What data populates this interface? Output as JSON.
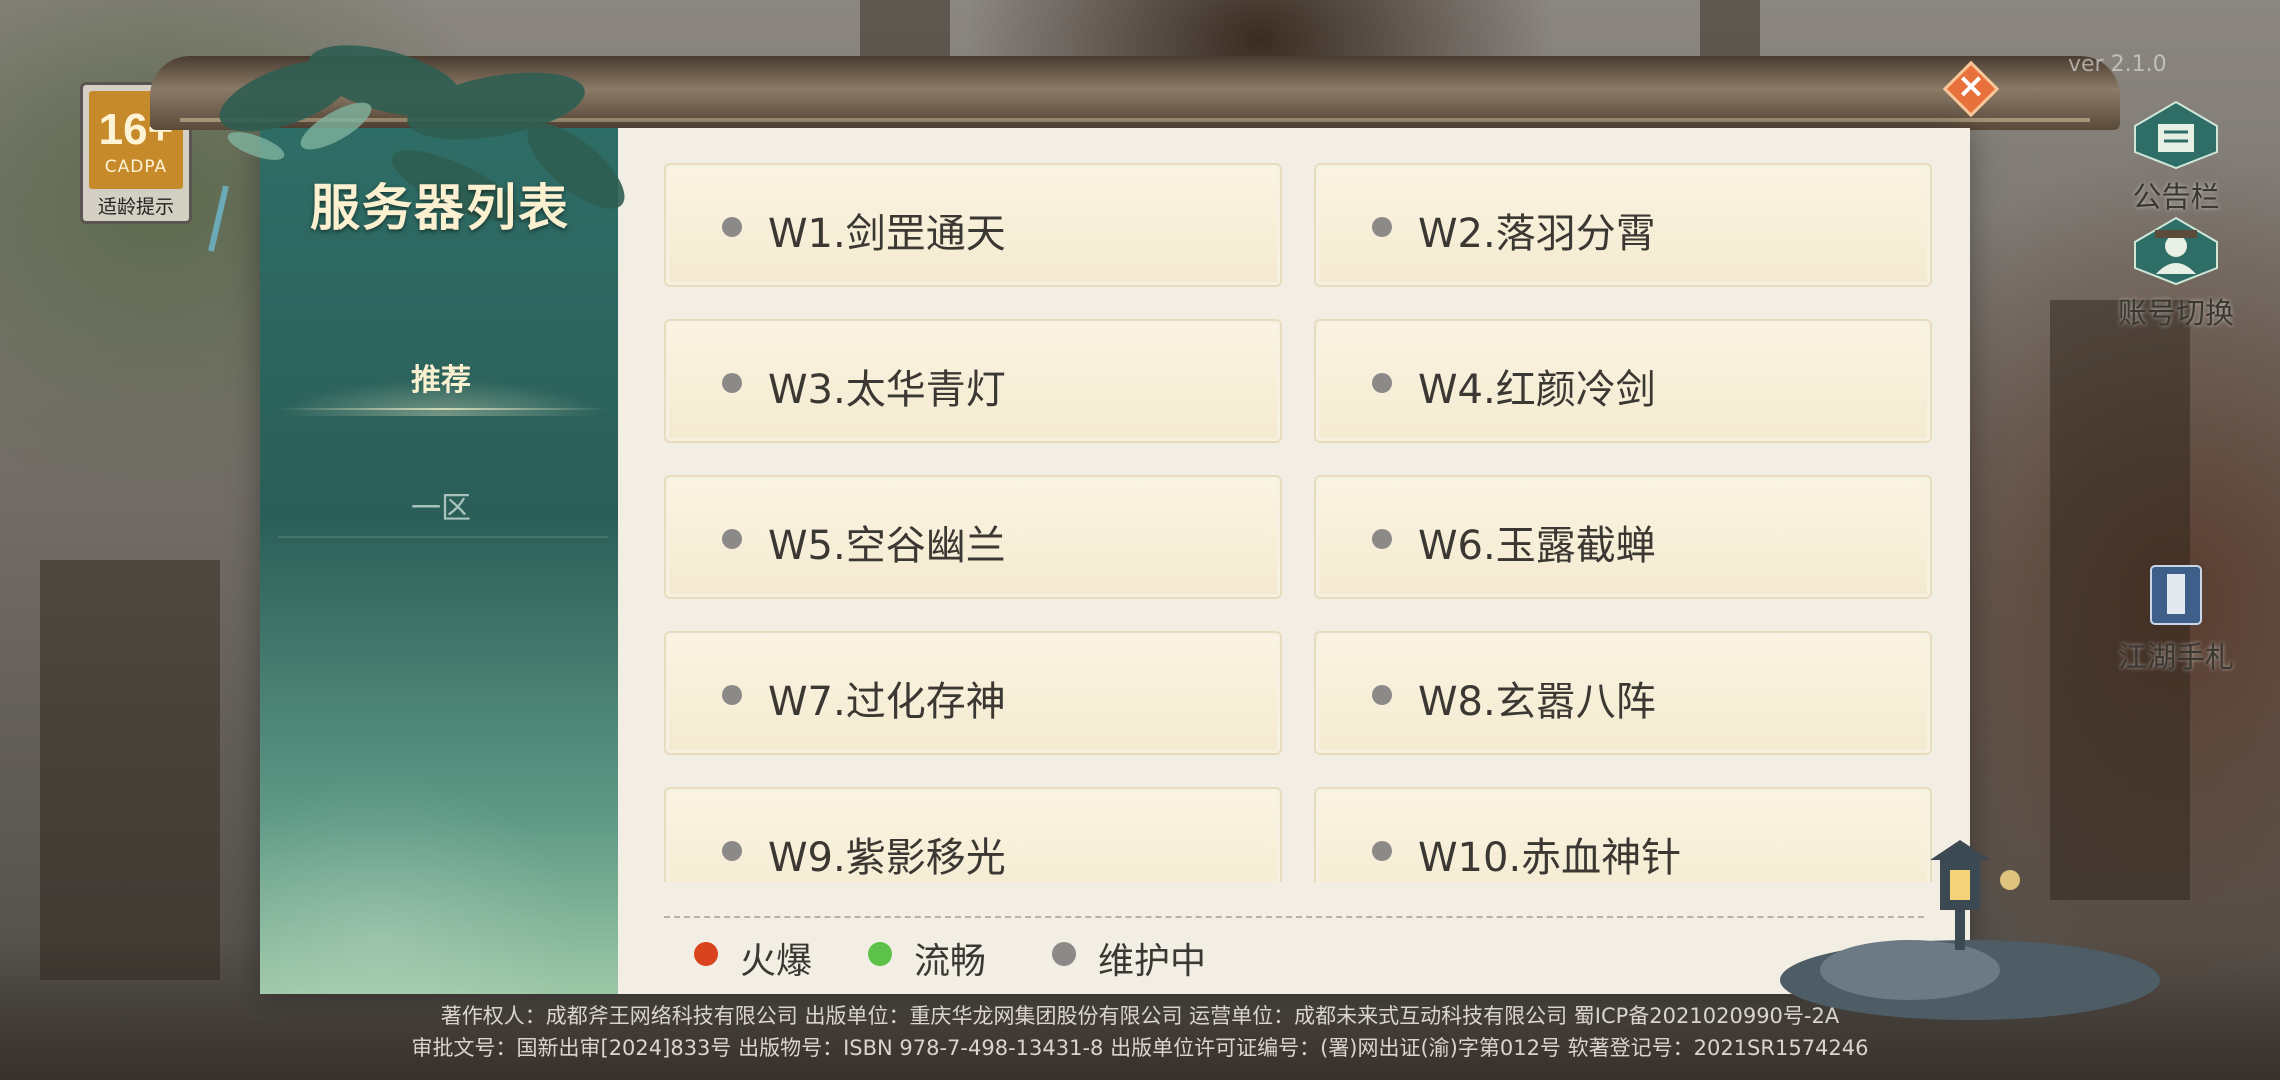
{
  "age_rating": {
    "value": "16+",
    "org": "CADPA",
    "tip": "适龄提示"
  },
  "version": "ver 2.1.0",
  "panel": {
    "title": "服务器列表",
    "tabs": [
      {
        "label": "推荐",
        "active": true
      },
      {
        "label": "一区",
        "active": false
      }
    ],
    "servers": [
      {
        "name": "W1.剑罡通天",
        "status": "maintenance"
      },
      {
        "name": "W2.落羽分霄",
        "status": "maintenance"
      },
      {
        "name": "W3.太华青灯",
        "status": "maintenance"
      },
      {
        "name": "W4.红颜冷剑",
        "status": "maintenance"
      },
      {
        "name": "W5.空谷幽兰",
        "status": "maintenance"
      },
      {
        "name": "W6.玉露截蝉",
        "status": "maintenance"
      },
      {
        "name": "W7.过化存神",
        "status": "maintenance"
      },
      {
        "name": "W8.玄嚣八阵",
        "status": "maintenance"
      },
      {
        "name": "W9.紫影移光",
        "status": "maintenance"
      },
      {
        "name": "W10.赤血神针",
        "status": "maintenance"
      }
    ],
    "legend": [
      {
        "label": "火爆",
        "color": "#d9441f"
      },
      {
        "label": "流畅",
        "color": "#5cc24a"
      },
      {
        "label": "维护中",
        "color": "#8c8a88"
      }
    ]
  },
  "right_buttons": {
    "notice": {
      "label": "公告栏",
      "icon": "notice-board-icon"
    },
    "account_switch": {
      "label": "账号切换",
      "icon": "account-switch-icon"
    },
    "handbook": {
      "label": "江湖手札",
      "icon": "handbook-icon"
    }
  },
  "footer": {
    "line1": "著作权人：成都斧王网络科技有限公司 出版单位：重庆华龙网集团股份有限公司 运营单位：成都未来式互动科技有限公司 蜀ICP备2021020990号-2A",
    "line2": "审批文号：国新出审[2024]833号 出版物号：ISBN 978-7-498-13431-8 出版单位许可证编号：(署)网出证(渝)字第012号 软著登记号：2021SR1574246"
  },
  "colors": {
    "maintenance": "#8c8a88",
    "hot": "#d9441f",
    "smooth": "#5cc24a"
  }
}
